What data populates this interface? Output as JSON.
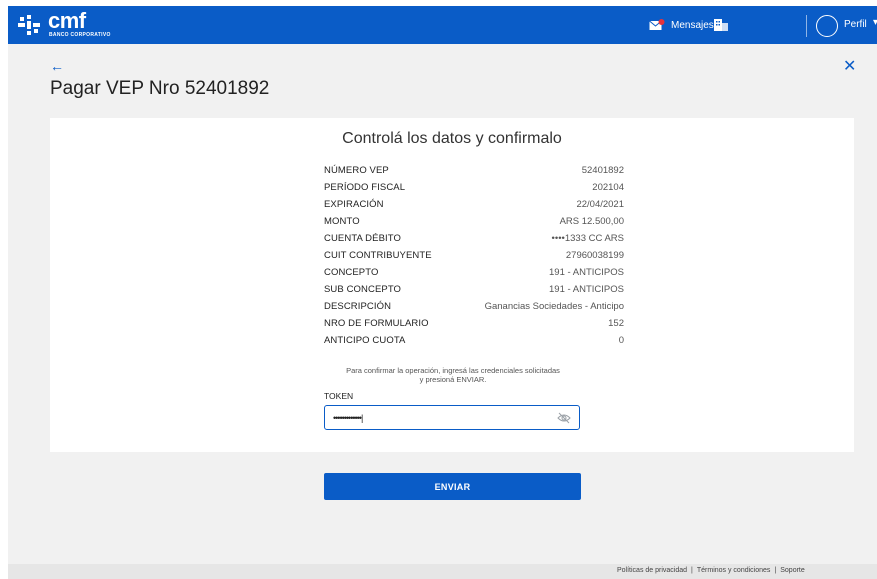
{
  "header": {
    "brand_name": "cmf",
    "brand_sub": "BANCO CORPORATIVO",
    "messages_label": "Mensajes",
    "profile_label": "Perfil",
    "accent_color": "#0a5cc7",
    "notification_color": "#e5323a"
  },
  "page": {
    "title": "Pagar VEP Nro 52401892"
  },
  "card": {
    "title": "Controlá los datos y confirmalo",
    "rows": [
      {
        "label": "NÚMERO VEP",
        "value": "52401892"
      },
      {
        "label": "PERÍODO FISCAL",
        "value": "202104"
      },
      {
        "label": "EXPIRACIÓN",
        "value": "22/04/2021"
      },
      {
        "label": "MONTO",
        "value": "ARS 12.500,00"
      },
      {
        "label": "CUENTA DÉBITO",
        "value": "••••1333  CC ARS"
      },
      {
        "label": "CUIT CONTRIBUYENTE",
        "value": "27960038199"
      },
      {
        "label": "CONCEPTO",
        "value": "191 - ANTICIPOS"
      },
      {
        "label": "SUB CONCEPTO",
        "value": "191 - ANTICIPOS"
      },
      {
        "label": "DESCRIPCIÓN",
        "value": "Ganancias Sociedades - Anticipo"
      },
      {
        "label": "NRO DE FORMULARIO",
        "value": "152"
      },
      {
        "label": "ANTICIPO CUOTA",
        "value": "0"
      }
    ],
    "confirm_text_1": "Para confirmar la operación, ingresá las credenciales solicitadas",
    "confirm_text_2": "y presioná ENVIAR.",
    "token_label": "TOKEN",
    "token_value": "•••••••••••••|"
  },
  "actions": {
    "send_label": "ENVIAR"
  },
  "footer": {
    "privacy": "Políticas de privacidad",
    "terms": "Términos y condiciones",
    "support": "Soporte",
    "separator": "|"
  }
}
